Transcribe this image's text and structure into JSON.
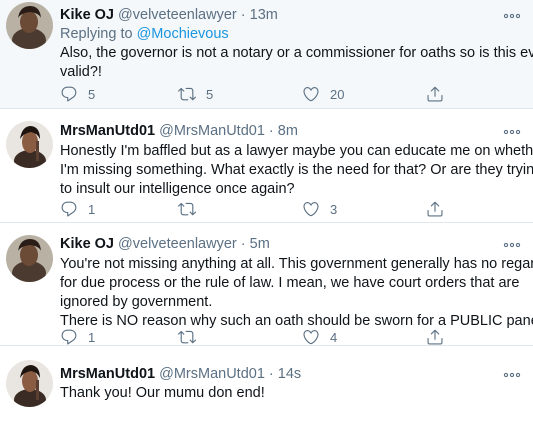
{
  "tweets": [
    {
      "name": "Kike OJ",
      "handle": "@velveteenlawyer",
      "dot": "·",
      "time": "13m",
      "replying_label": "Replying to",
      "replying_to": "@Mochievous",
      "lines": [
        "Also, the governor is not a notary or a commissioner for oaths so is this even",
        "valid?!"
      ],
      "replies": "5",
      "retweets": "5",
      "likes": "20"
    },
    {
      "name": "MrsManUtd01",
      "handle": "@MrsManUtd01",
      "dot": "·",
      "time": "8m",
      "lines": [
        "Honestly I'm baffled but as a lawyer maybe you can educate me on whether",
        "I'm missing something. What exactly is the need for that? Or are they trying",
        "to insult our intelligence once again?"
      ],
      "replies": "1",
      "retweets": "",
      "likes": "3"
    },
    {
      "name": "Kike OJ",
      "handle": "@velveteenlawyer",
      "dot": "·",
      "time": "5m",
      "lines": [
        "You're not missing anything at all. This government generally has no regard",
        "for due process or the rule of law. I mean, we have court orders that are",
        "ignored by government.",
        "There is NO reason why such an oath should be sworn for a PUBLIC panel"
      ],
      "replies": "1",
      "retweets": "",
      "likes": "4"
    },
    {
      "name": "MrsManUtd01",
      "handle": "@MrsManUtd01",
      "dot": "·",
      "time": "14s",
      "lines": [
        "Thank you! Our mumu don end!"
      ]
    }
  ],
  "icons": {
    "reply": "reply-icon",
    "retweet": "retweet-icon",
    "like": "heart-icon",
    "share": "share-icon",
    "more": "more-icon"
  },
  "colors": {
    "highlight_bg": "#f5f8fa",
    "divider": "#e1e8ed",
    "muted": "#5b7083",
    "mention": "#1b95e0"
  }
}
